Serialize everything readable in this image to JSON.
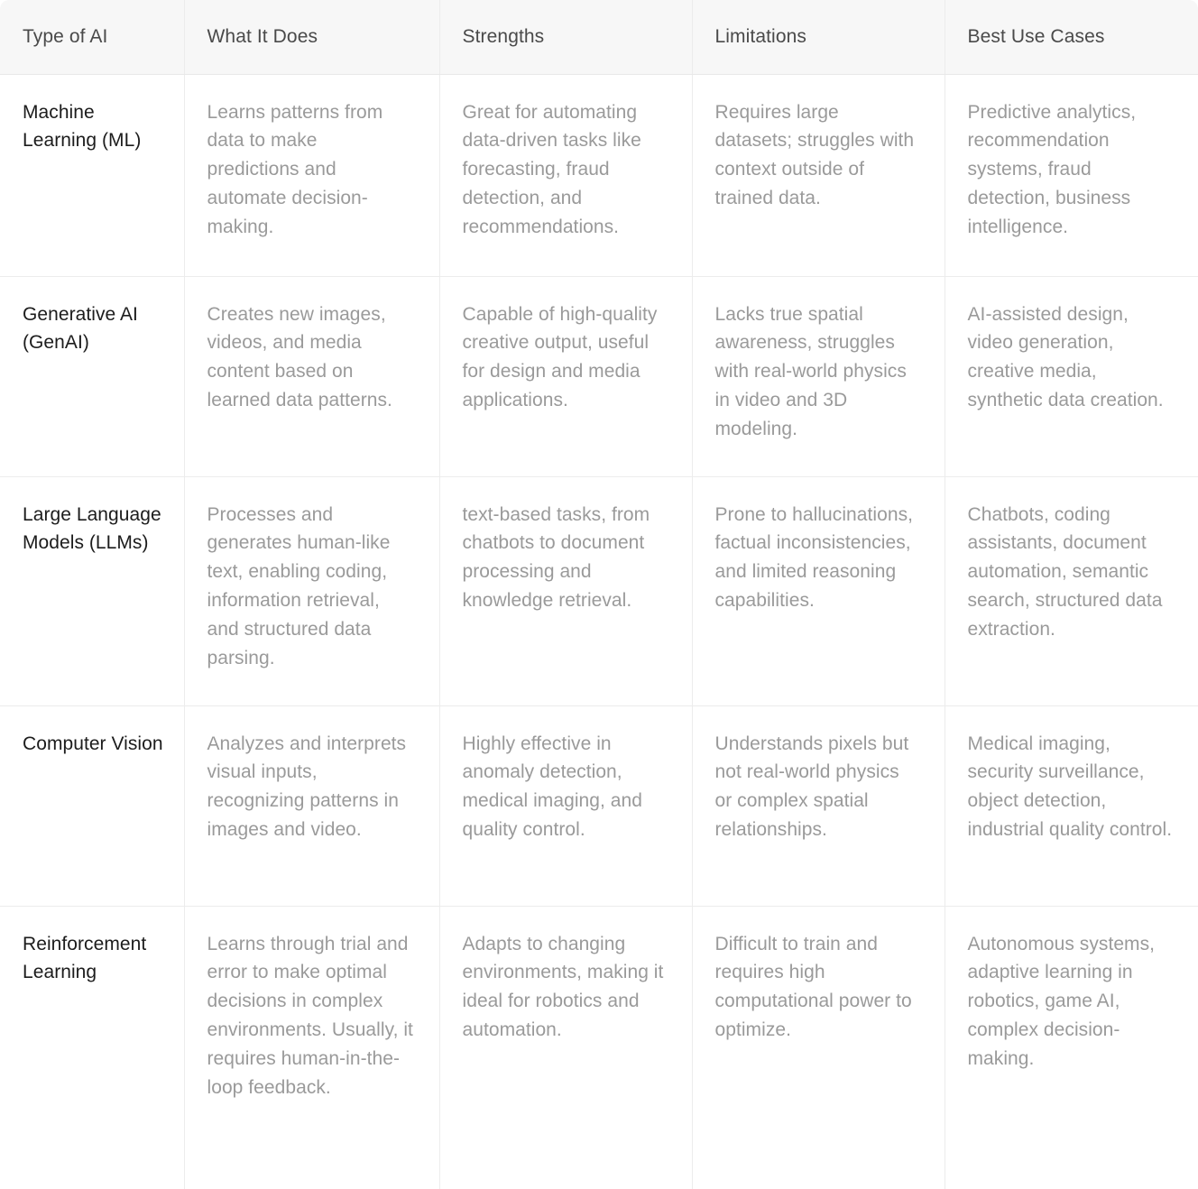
{
  "table": {
    "columns": [
      "Type of AI",
      "What It Does",
      "Strengths",
      "Limitations",
      "Best Use Cases"
    ],
    "rows": [
      {
        "type": "Machine Learning (ML)",
        "what_it_does": "Learns patterns from data to make predictions and automate decision-making.",
        "strengths": "Great for automating data-driven tasks like forecasting, fraud detection, and recommendations.",
        "limitations": "Requires large datasets; struggles with context outside of trained data.",
        "best_use_cases": "Predictive analytics, recommendation systems, fraud detection, business intelligence."
      },
      {
        "type": "Generative AI (GenAI)",
        "what_it_does": "Creates new images, videos, and media content based on learned data patterns.",
        "strengths": "Capable of high-quality creative output, useful for design and media applications.",
        "limitations": "Lacks true spatial awareness, struggles with real-world physics in video and 3D modeling.",
        "best_use_cases": "AI-assisted design, video generation, creative media, synthetic data creation."
      },
      {
        "type": "Large Language Models (LLMs)",
        "what_it_does": "Processes and generates human-like text, enabling coding, information retrieval, and structured data parsing.",
        "strengths": "text-based tasks, from chatbots to document processing and knowledge retrieval.",
        "limitations": "Prone to hallucinations, factual inconsistencies, and limited reasoning capabilities.",
        "best_use_cases": "Chatbots, coding assistants, document automation, semantic search, structured data extraction."
      },
      {
        "type": "Computer Vision",
        "what_it_does": "Analyzes and interprets visual inputs, recognizing patterns in images and video.",
        "strengths": "Highly effective in anomaly detection, medical imaging, and quality control.",
        "limitations": "Understands pixels but not real-world physics or complex spatial relationships.",
        "best_use_cases": "Medical imaging, security surveillance, object detection, industrial quality control."
      },
      {
        "type": "Reinforcement Learning",
        "what_it_does": "Learns through trial and error to make optimal decisions in complex environments. Usually, it requires human-in-the-loop feedback.",
        "strengths": "Adapts to changing environments, making it ideal for robotics and automation.",
        "limitations": "Difficult to train and requires high computational power to optimize.",
        "best_use_cases": "Autonomous systems, adaptive learning in robotics, game AI, complex decision-making."
      }
    ]
  },
  "colors": {
    "header_background": "#f7f7f7",
    "header_text": "#4a4a4a",
    "body_text": "#9a9a9a",
    "type_text": "#1c1c1c",
    "border": "#ececec",
    "page_background": "#ffffff"
  }
}
